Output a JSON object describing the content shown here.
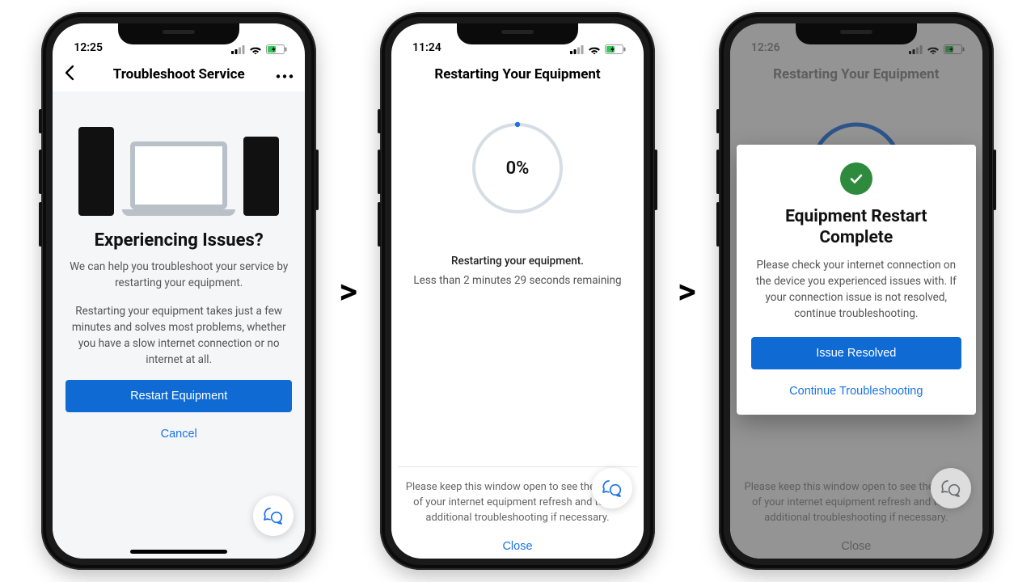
{
  "arrow_glyph": ">",
  "screens": [
    {
      "status_time": "12:25",
      "nav": {
        "title": "Troubleshoot Service",
        "has_back": true,
        "has_more": true
      },
      "heading": "Experiencing Issues?",
      "para1": "We can help you troubleshoot your service by restarting your equipment.",
      "para2": "Restarting your equipment takes just a few minutes and solves most problems, whether you have a slow internet connection or no internet at all.",
      "primary_btn": "Restart Equipment",
      "secondary_btn": "Cancel"
    },
    {
      "status_time": "11:24",
      "nav": {
        "title": "Restarting Your Equipment"
      },
      "progress_pct": "0%",
      "status_line1": "Restarting your equipment.",
      "status_line2": "Less than 2 minutes 29 seconds remaining",
      "footer_note": "Please keep this window open to see the results of your internet equipment refresh and to get additional troubleshooting if necessary.",
      "close_label": "Close"
    },
    {
      "status_time": "12:26",
      "nav": {
        "title": "Restarting Your Equipment"
      },
      "modal": {
        "heading": "Equipment Restart Complete",
        "body": "Please check your internet connection on the device you experienced issues with. If your connection issue is not resolved, continue troubleshooting.",
        "primary_btn": "Issue Resolved",
        "secondary_btn": "Continue Troubleshooting"
      },
      "footer_note": "Please keep this window open to see the results of your internet equipment refresh and to get additional troubleshooting if necessary.",
      "close_label": "Close"
    }
  ]
}
